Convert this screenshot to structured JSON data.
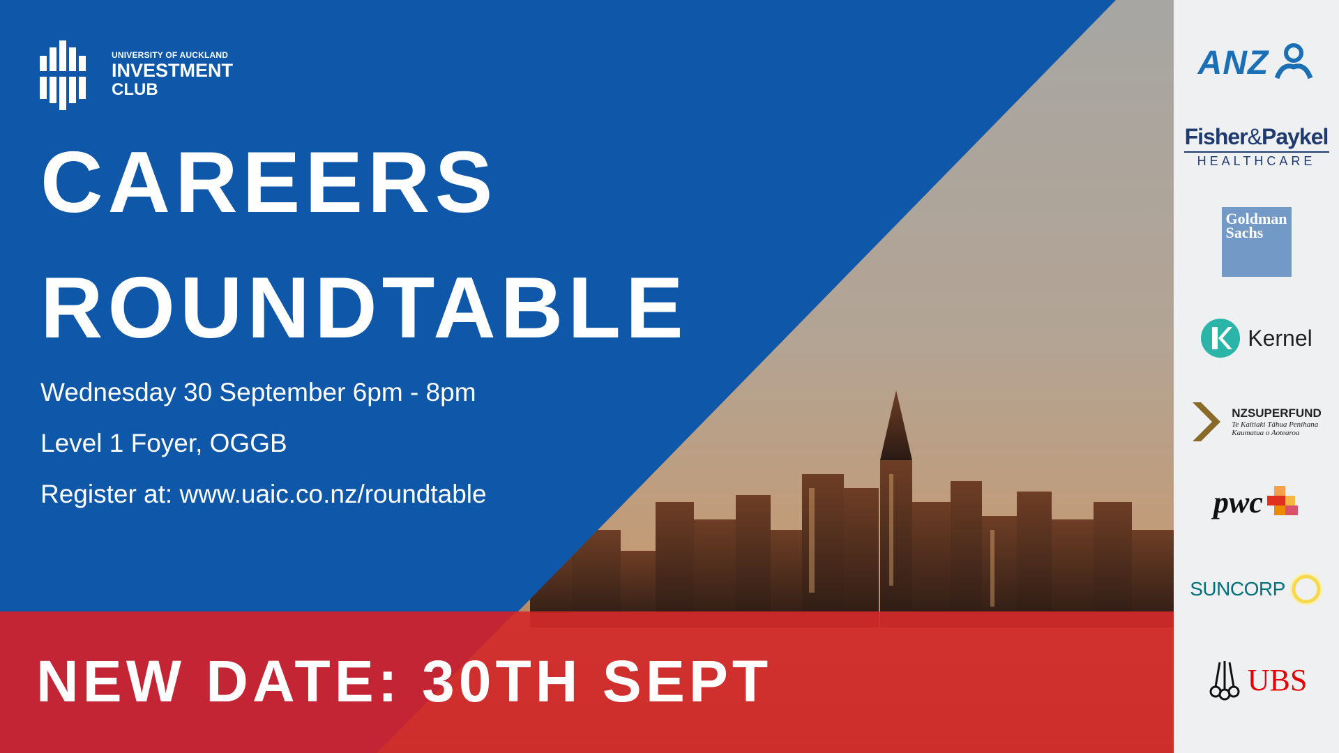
{
  "club": {
    "line1": "UNIVERSITY OF AUCKLAND",
    "line2": "INVESTMENT",
    "line3": "CLUB"
  },
  "title": {
    "line1": "CAREERS",
    "line2": "ROUNDTABLE"
  },
  "details": {
    "date": "Wednesday 30 September 6pm - 8pm",
    "venue": "Level 1 Foyer, OGGB",
    "register": "Register at: www.uaic.co.nz/roundtable"
  },
  "banner": {
    "text": "NEW DATE: 30TH SEPT"
  },
  "sponsors": {
    "anz": "ANZ",
    "fp_line1": "Fisher",
    "fp_amp": "&",
    "fp_line1b": "Paykel",
    "fp_line2": "HEALTHCARE",
    "gs_line1": "Goldman",
    "gs_line2": "Sachs",
    "kernel": "Kernel",
    "nzsf_a": "NZ",
    "nzsf_b": "SUPERFUND",
    "nzsf_line2": "Te Kaitiaki Tāhua Penihana",
    "nzsf_line3": "Kaumatua o Aotearoa",
    "pwc": "pwc",
    "suncorp": "SUNCORP",
    "ubs": "UBS"
  },
  "colors": {
    "blue": "#0f57a8",
    "red": "#d42a2a",
    "white": "#ffffff",
    "anz_blue": "#1a6fb5",
    "fp_navy": "#1f3a6e",
    "gs_blue": "#7399c6",
    "kernel_teal": "#2bb5a8",
    "nzsf_gold": "#8a6a28",
    "pwc_orange": "#e0301e",
    "suncorp_teal": "#00707a",
    "ubs_red": "#e60000"
  }
}
